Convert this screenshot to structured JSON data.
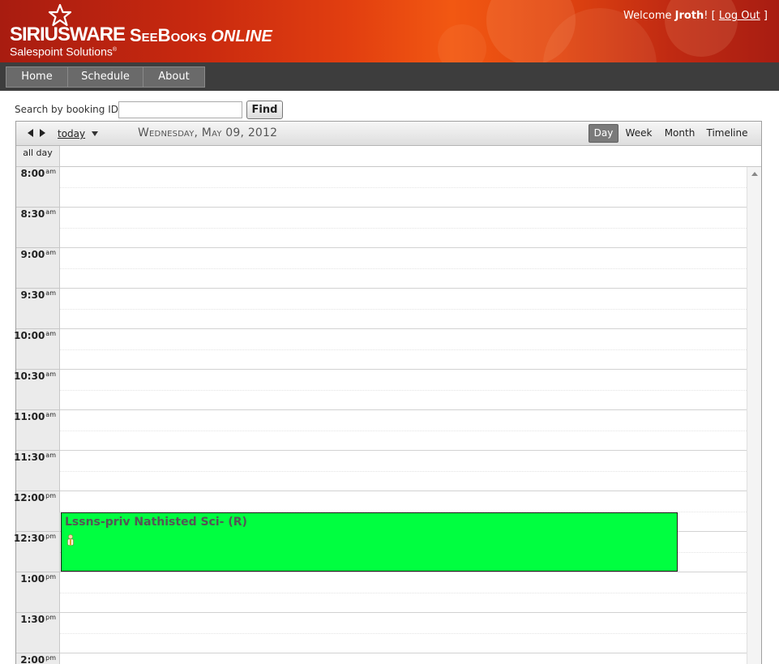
{
  "header": {
    "logo_text": "SIRIUSWARE",
    "logo_sub": "Salespoint Solutions",
    "product_part1": "SeeBooks",
    "product_part2": "ONLINE",
    "welcome_prefix": "Welcome",
    "username": "Jroth",
    "welcome_mid": "! [",
    "logout_label": "Log Out",
    "welcome_suffix": "]"
  },
  "nav": {
    "items": [
      {
        "label": "Home"
      },
      {
        "label": "Schedule"
      },
      {
        "label": "About"
      }
    ]
  },
  "search": {
    "label": "Search by booking ID:",
    "value": "",
    "placeholder": "",
    "button_label": "Find"
  },
  "calendar": {
    "today_label": "today",
    "date_title": "Wednesday, May 09, 2012",
    "views": [
      {
        "label": "Day",
        "active": true
      },
      {
        "label": "Week",
        "active": false
      },
      {
        "label": "Month",
        "active": false
      },
      {
        "label": "Timeline",
        "active": false
      }
    ],
    "allday_label": "all day",
    "time_slots": [
      {
        "time": "8:00",
        "ampm": "am"
      },
      {
        "time": "8:30",
        "ampm": "am"
      },
      {
        "time": "9:00",
        "ampm": "am"
      },
      {
        "time": "9:30",
        "ampm": "am"
      },
      {
        "time": "10:00",
        "ampm": "am"
      },
      {
        "time": "10:30",
        "ampm": "am"
      },
      {
        "time": "11:00",
        "ampm": "am"
      },
      {
        "time": "11:30",
        "ampm": "am"
      },
      {
        "time": "12:00",
        "ampm": "pm"
      },
      {
        "time": "12:30",
        "ampm": "pm"
      },
      {
        "time": "1:00",
        "ampm": "pm"
      },
      {
        "time": "1:30",
        "ampm": "pm"
      },
      {
        "time": "2:00",
        "ampm": "pm"
      }
    ],
    "event": {
      "title": "Lssns-priv Nathisted Sci- (R)",
      "color": "#00ff40",
      "icon": "person-icon"
    }
  },
  "colors": {
    "nav_bg": "#3d3d3d",
    "nav_item_bg": "#6a6a6a",
    "active_view_bg": "#7a7a7a"
  }
}
